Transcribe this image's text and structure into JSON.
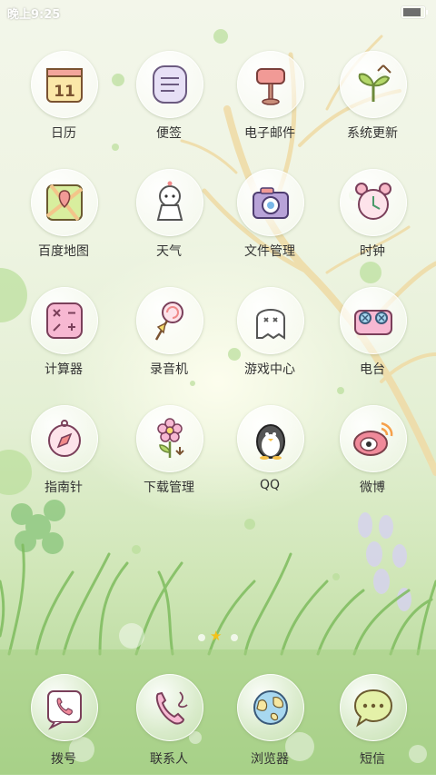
{
  "status_bar": {
    "time": "晚上9:25",
    "battery_level": 0.9
  },
  "apps": [
    {
      "label": "日历",
      "icon": "calendar-icon"
    },
    {
      "label": "便签",
      "icon": "notepad-icon"
    },
    {
      "label": "电子邮件",
      "icon": "mailbox-icon"
    },
    {
      "label": "系统更新",
      "icon": "sprout-update-icon"
    },
    {
      "label": "百度地图",
      "icon": "map-icon"
    },
    {
      "label": "天气",
      "icon": "weather-doll-icon"
    },
    {
      "label": "文件管理",
      "icon": "camera-folder-icon"
    },
    {
      "label": "时钟",
      "icon": "alarm-clock-icon"
    },
    {
      "label": "计算器",
      "icon": "calculator-icon"
    },
    {
      "label": "录音机",
      "icon": "lollipop-recorder-icon"
    },
    {
      "label": "游戏中心",
      "icon": "ghost-icon"
    },
    {
      "label": "电台",
      "icon": "cassette-radio-icon"
    },
    {
      "label": "指南针",
      "icon": "compass-icon"
    },
    {
      "label": "下载管理",
      "icon": "flower-download-icon"
    },
    {
      "label": "QQ",
      "icon": "penguin-icon"
    },
    {
      "label": "微博",
      "icon": "weibo-eye-icon"
    }
  ],
  "pager": {
    "current_page": 2,
    "total_pages": 3
  },
  "dock": [
    {
      "label": "拨号",
      "icon": "phone-icon"
    },
    {
      "label": "联系人",
      "icon": "telephone-handset-icon"
    },
    {
      "label": "浏览器",
      "icon": "globe-icon"
    },
    {
      "label": "短信",
      "icon": "chat-bubble-icon"
    }
  ]
}
